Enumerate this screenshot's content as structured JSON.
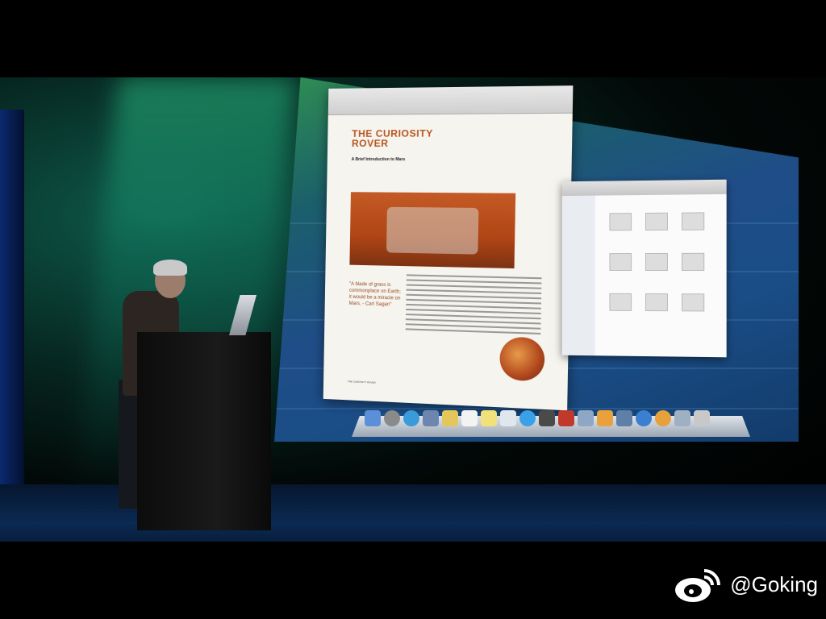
{
  "document": {
    "title": "THE CURIOSITY ROVER",
    "subtitle": "A Brief Introduction to Mars",
    "quote": "\"A blade of grass is commonplace on Earth; it would be a miracle on Mars. - Carl Sagan\"",
    "footer": "THE CURIOSITY ROVER"
  },
  "watermark": {
    "handle": "@Goking",
    "icon": "weibo-icon"
  },
  "colors": {
    "doc_title": "#b8541c",
    "screen_green": "#2f8f52",
    "screen_blue": "#1f4d88"
  }
}
